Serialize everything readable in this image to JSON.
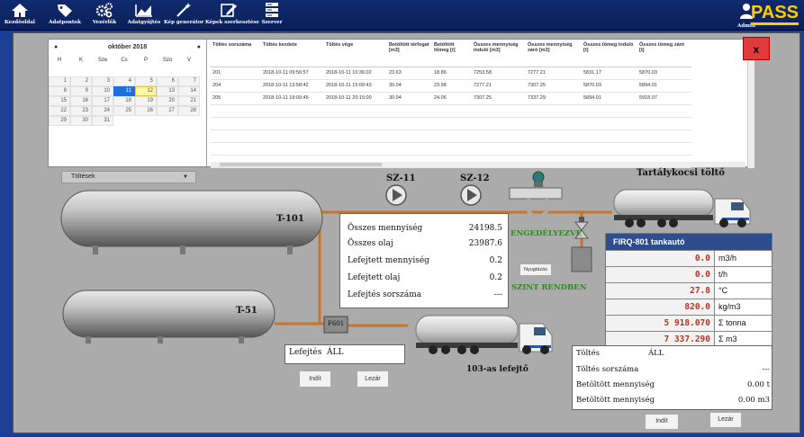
{
  "toolbar": {
    "items": [
      {
        "label": "Kezdőoldal",
        "icon": "home-icon"
      },
      {
        "label": "Adatpontok",
        "icon": "tag-icon"
      },
      {
        "label": "Vezérlők",
        "icon": "gears-icon"
      },
      {
        "label": "Adatgyűjtés",
        "icon": "chart-icon"
      },
      {
        "label": "Kép generátor",
        "icon": "wand-icon"
      },
      {
        "label": "Képek szerkesztése",
        "icon": "edit-icon"
      },
      {
        "label": "Szerver",
        "icon": "server-icon"
      }
    ],
    "user_label": "Admin",
    "logo_text": "PASS"
  },
  "calendar": {
    "month_label": "október 2018",
    "weekdays": [
      "H",
      "K",
      "Sze",
      "Cs",
      "P",
      "Szo",
      "V"
    ],
    "weeks": [
      [
        "",
        "",
        "",
        "",
        "",
        "",
        ""
      ],
      [
        "1",
        "2",
        "3",
        "4",
        "5",
        "6",
        "7"
      ],
      [
        "8",
        "9",
        "10",
        "11",
        "12",
        "13",
        "14"
      ],
      [
        "15",
        "16",
        "17",
        "18",
        "19",
        "20",
        "21"
      ],
      [
        "22",
        "23",
        "24",
        "25",
        "26",
        "27",
        "28"
      ],
      [
        "29",
        "30",
        "31",
        "",
        "",
        "",
        ""
      ]
    ],
    "selected": "11",
    "today": "12"
  },
  "table": {
    "headers": [
      "Töltés sorszáma",
      "Töltés kezdete",
      "Töltés vége",
      "Betöltött térfogat [m3]",
      "Betöltött tömeg [t]",
      "Összes mennyiség induló [m3]",
      "Összes mennyiség záró [m3]",
      "Összes tömeg induló [t]",
      "Összes tömeg záró [t]"
    ],
    "rows": [
      [
        "201",
        "2018-10-11 09:56:57",
        "2018-10-11 10:36:02",
        "23.63",
        "18.86",
        "7253.58",
        "7277.21",
        "5831.17",
        "5870.03"
      ],
      [
        "204",
        "2018-10-11 13:58:42",
        "2018-10-11 15:00:43",
        "30.04",
        "23.98",
        "7277.21",
        "7307.25",
        "5870.03",
        "5894.01"
      ],
      [
        "205",
        "2018-10-11 19:00:45",
        "2018-10-11 20:15:00",
        "30.04",
        "24.06",
        "7307.25",
        "7337.29",
        "5894.01",
        "5918.07"
      ]
    ]
  },
  "close_label": "x",
  "select_value": "Töltések",
  "tanks": {
    "t101": "T-101",
    "t51": "T-51"
  },
  "pumps": {
    "sz11": "SZ-11",
    "sz12": "SZ-12"
  },
  "truck_title": "Tartálykocsi töltő",
  "permission_status": "ENGEDÉLYEZVE",
  "level_status": "SZINT RENDBEN",
  "reset_button": "Nyugtázás",
  "filter_label": "F601",
  "unload_truck_label": "103-as lefejtő",
  "info": {
    "rows": [
      {
        "label": "Összes mennyiség",
        "value": "24198.5"
      },
      {
        "label": "Összes olaj",
        "value": "23987.6"
      },
      {
        "label": "Lefejtett mennyiség",
        "value": "0.2"
      },
      {
        "label": "Lefejtett olaj",
        "value": "0.2"
      },
      {
        "label": "Lefejtés sorszáma",
        "value": "---"
      }
    ]
  },
  "firq": {
    "title": "FIRQ-801 tankautó",
    "rows": [
      {
        "value": "0.0",
        "unit": "m3/h"
      },
      {
        "value": "0.0",
        "unit": "t/h"
      },
      {
        "value": "27.8",
        "unit": "°C"
      },
      {
        "value": "820.0",
        "unit": "kg/m3"
      },
      {
        "value": "5 918.070",
        "unit": "Σ tonna"
      },
      {
        "value": "7 337.290",
        "unit": "Σ m3"
      }
    ]
  },
  "unloading": {
    "label": "Lefejtés",
    "state": "ÁLL",
    "start_label": "Indít",
    "stop_label": "Lezár"
  },
  "loading": {
    "label": "Töltés",
    "state": "ÁLL",
    "rows": [
      {
        "label": "Töltés sorszáma",
        "value": "---"
      },
      {
        "label": "Betöltött mennyiség",
        "value": "0.00 t"
      },
      {
        "label": "Betöltött mennyiség",
        "value": "0.00 m3"
      }
    ],
    "start_label": "Indít",
    "stop_label": "Lezár"
  },
  "colors": {
    "background": "#1b3f94",
    "pipe": "#c8742a",
    "status_green": "#2f8a1f",
    "meter_value": "#c03020",
    "close": "#e23a3a"
  }
}
